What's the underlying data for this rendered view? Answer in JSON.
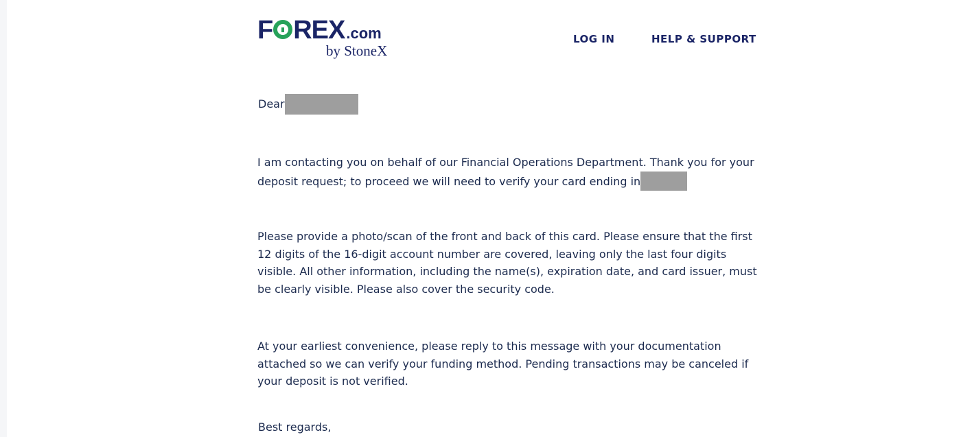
{
  "header": {
    "logo": {
      "letter_f": "F",
      "letters_rex": "REX",
      "suffix": ".com",
      "byline": "by StoneX",
      "brand_colors": {
        "navy": "#1a2466",
        "green": "#27a25a"
      }
    },
    "nav": {
      "login_label": "LOG IN",
      "help_label": "HELP & SUPPORT"
    }
  },
  "email": {
    "greeting": "Dear",
    "paragraphs": [
      "I am contacting you on behalf of our Financial Operations Department. Thank you for your deposit request; to proceed we will need to verify your card ending in",
      "Please provide a photo/scan of the front and back of this card. Please ensure that the first 12 digits of the 16-digit account number are covered, leaving only the last four digits visible. All other information, including the name(s), expiration date, and card issuer, must be clearly visible. Please also cover the security code.",
      "At your earliest convenience, please reply to this message with your documentation attached so we can verify your funding method. Pending transactions may be canceled if your deposit is not verified."
    ],
    "signoff": "Best regards,",
    "redaction_color": "#9e9e9e",
    "text_color": "#1b2a4e"
  }
}
